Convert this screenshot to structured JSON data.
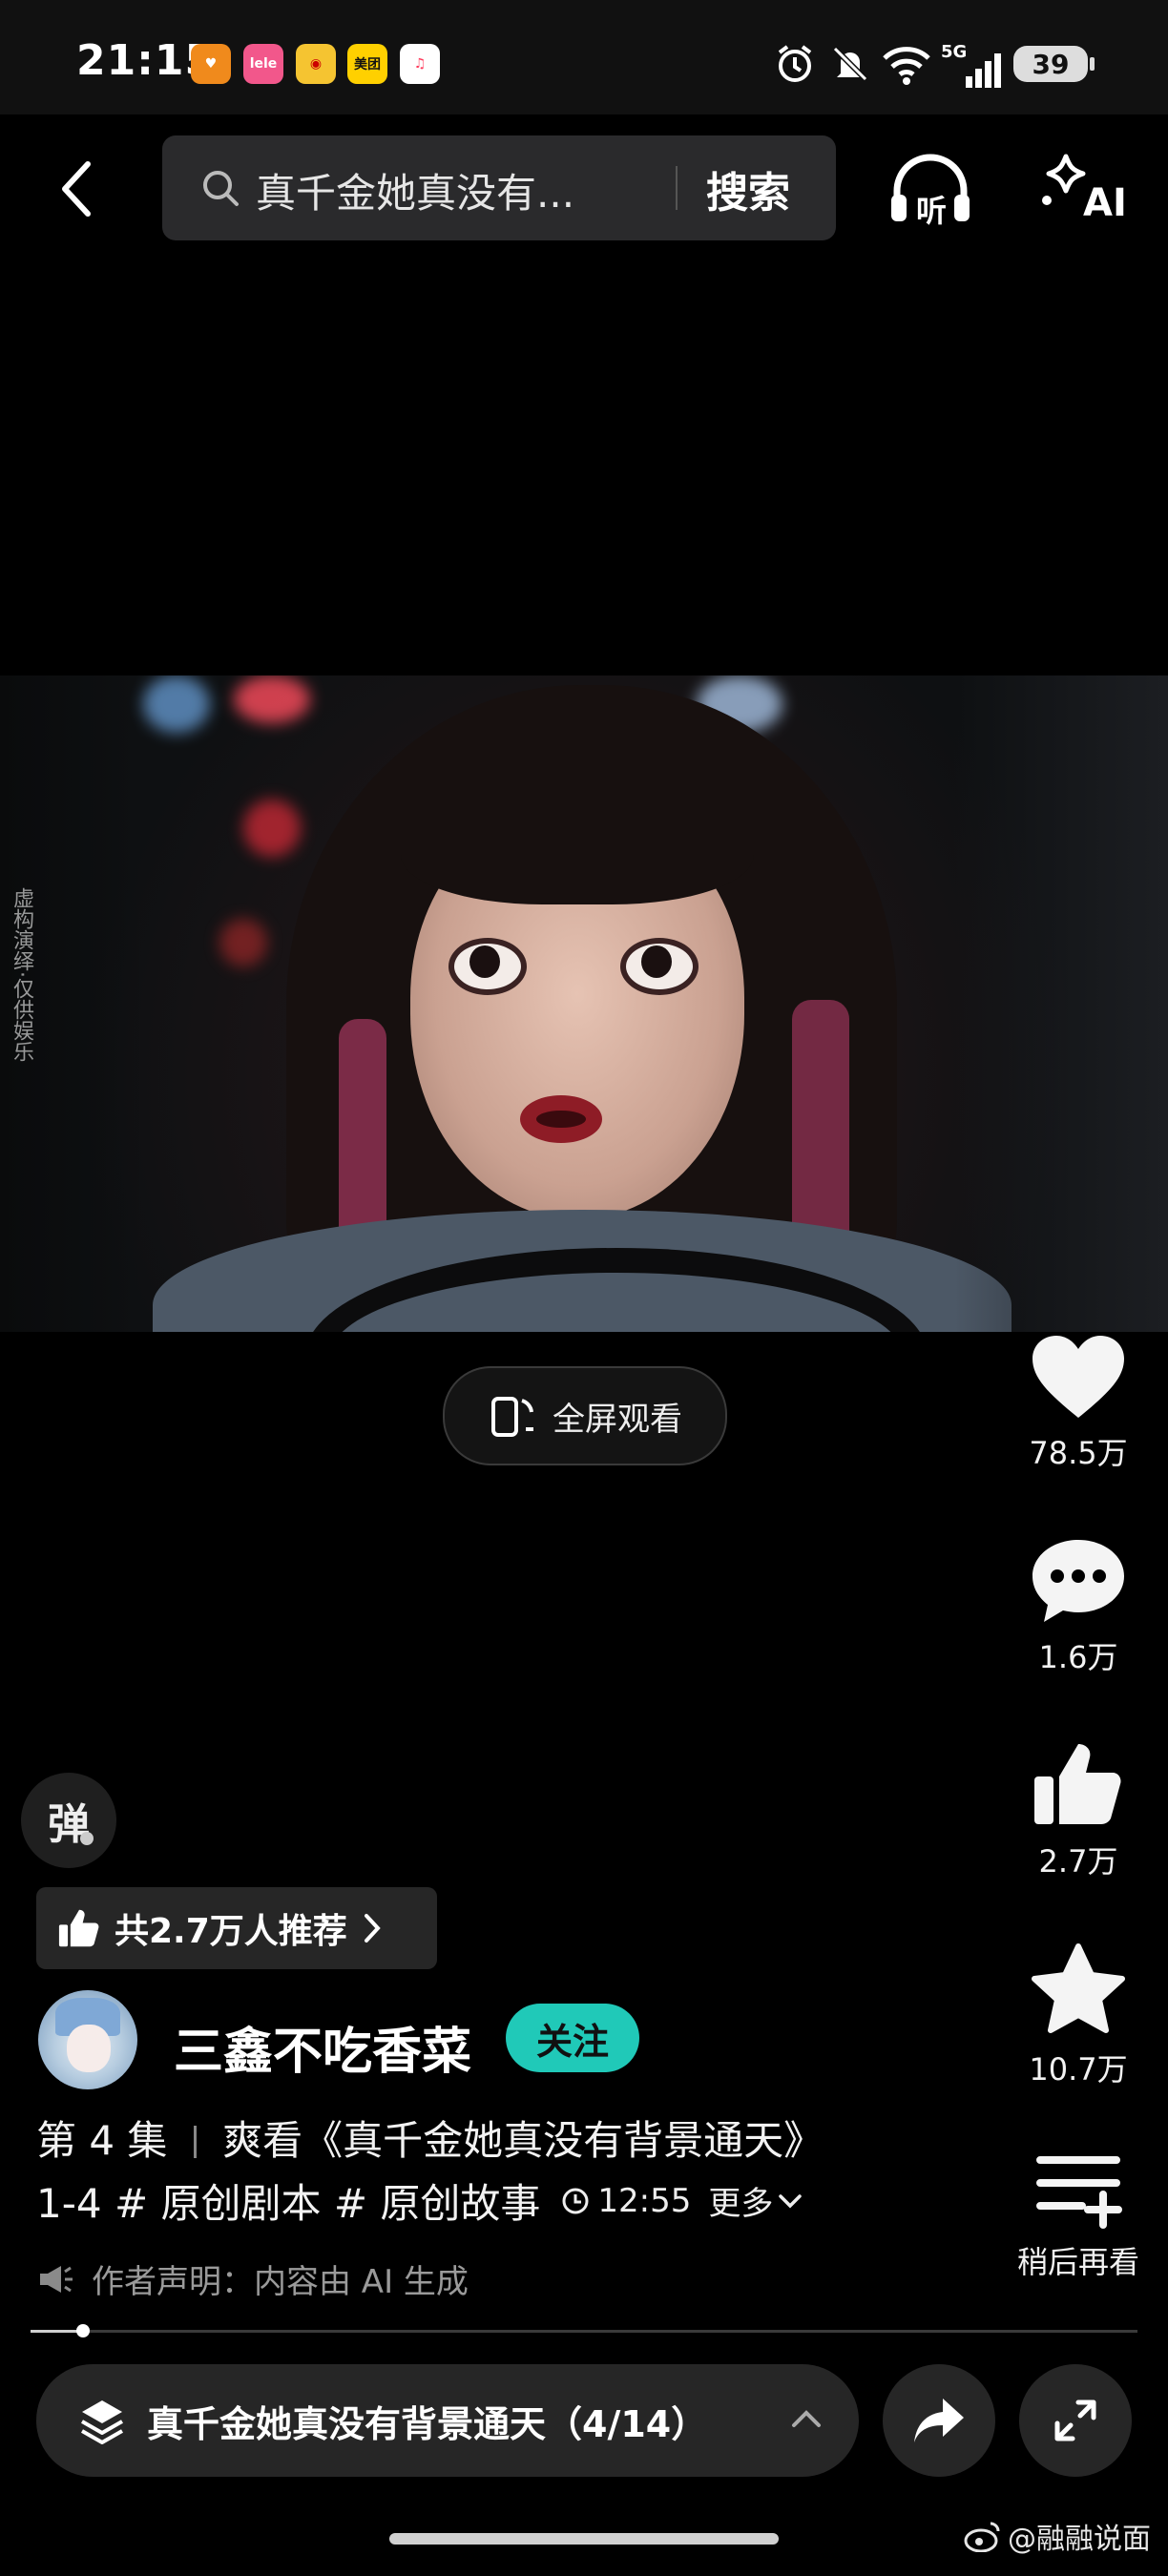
{
  "status_bar": {
    "time": "21:15",
    "battery": "39",
    "network": "5G",
    "app_icons": [
      {
        "name": "heart-app-icon",
        "label": "",
        "color": "#f08a1c"
      },
      {
        "name": "lele-app-icon",
        "label": "lele",
        "color": "#f2578b"
      },
      {
        "name": "weibo-app-icon",
        "label": "",
        "color": "#f5c431"
      },
      {
        "name": "meituan-app-icon",
        "label": "美团",
        "color": "#ffd000"
      },
      {
        "name": "music-app-icon",
        "label": "",
        "color": "#ff3b5c"
      }
    ]
  },
  "search": {
    "query": "真千金她真没有...",
    "button_label": "搜索"
  },
  "header": {
    "listen_label": "听",
    "ai_label": "AI"
  },
  "video": {
    "side_watermark": "虚构演绎·仅供娱乐",
    "fullscreen_label": "全屏观看"
  },
  "actions": {
    "like_count": "78.5万",
    "comment_count": "1.6万",
    "recommend_count": "2.7万",
    "favorite_count": "10.7万",
    "watch_later_label": "稍后再看"
  },
  "danmaku": {
    "label": "弹"
  },
  "recommend_pill": {
    "label": "共2.7万人推荐"
  },
  "author": {
    "name": "三鑫不吃香菜",
    "follow_label": "关注"
  },
  "description": {
    "episode": "第 4 集",
    "title_text": "爽看《真千金她真没有背景通天》",
    "line2": "1-4 # 原创剧本 # 原创故事",
    "duration": "12:55",
    "more_label": "更多"
  },
  "notice": {
    "text": "作者声明：内容由 AI 生成"
  },
  "progress": {
    "fraction": 0.047
  },
  "series": {
    "label": "真千金她真没有背景通天（4/14）"
  },
  "credit": {
    "text": "@融融说面"
  },
  "colors": {
    "accent": "#20c9b8",
    "background": "#000000"
  }
}
